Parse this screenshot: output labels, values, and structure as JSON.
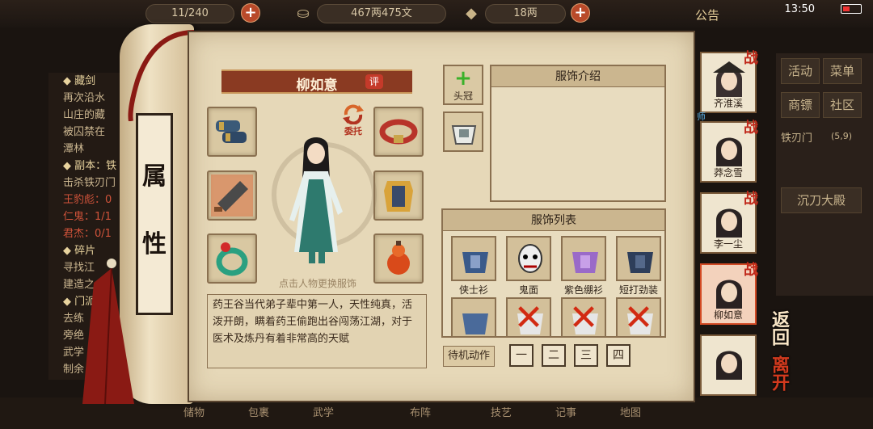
{
  "topbar": {
    "stamina": "11/240",
    "silver": "467两475文",
    "gold": "18两",
    "notice": "公告",
    "time": "13:50"
  },
  "quests": [
    {
      "text": "◆ 藏剑",
      "style": "h"
    },
    {
      "text": "再次沿水",
      "style": ""
    },
    {
      "text": "山庄的藏",
      "style": ""
    },
    {
      "text": "被囚禁在",
      "style": ""
    },
    {
      "text": "潭林",
      "style": ""
    },
    {
      "text": "◆ 副本：铁",
      "style": "h"
    },
    {
      "text": "击杀铁刃门",
      "style": ""
    },
    {
      "text": "王豹彪：0",
      "style": "hl"
    },
    {
      "text": "仁鬼：1/1",
      "style": "hl"
    },
    {
      "text": "君杰：0/1",
      "style": "hl"
    },
    {
      "text": "◆ 碎片",
      "style": "h"
    },
    {
      "text": "寻找江",
      "style": ""
    },
    {
      "text": "建造之",
      "style": ""
    },
    {
      "text": "◆ 门派",
      "style": "h"
    },
    {
      "text": "去练",
      "style": ""
    },
    {
      "text": "旁绝",
      "style": ""
    },
    {
      "text": "武学",
      "style": ""
    },
    {
      "text": "制余",
      "style": ""
    }
  ],
  "right_menu": {
    "activity": "活动",
    "menu": "菜单",
    "escort": "商镖",
    "community": "社区",
    "location": "铁刃门",
    "coords": "(5,9)",
    "dungeon": "沉刀大殿"
  },
  "scroll_label": [
    "属",
    "性"
  ],
  "character": {
    "name": "柳如意",
    "rate_label": "评",
    "entrust_label": "委托",
    "hint": "点击人物更换服饰",
    "description": "药王谷当代弟子辈中第一人，天性纯真，活泼开朗，瞒着药王偷跑出谷闯荡江湖，对于医术及炼丹有着非常高的天赋"
  },
  "headgear_label": "头冠",
  "intro_title": "服饰介绍",
  "list_title": "服饰列表",
  "costumes": [
    {
      "label": "侠士衫",
      "locked": false
    },
    {
      "label": "鬼面",
      "locked": false
    },
    {
      "label": "紫色绷衫",
      "locked": false
    },
    {
      "label": "短打劲装",
      "locked": false
    },
    {
      "label": "",
      "locked": false
    },
    {
      "label": "",
      "locked": true
    },
    {
      "label": "",
      "locked": true
    },
    {
      "label": "",
      "locked": true
    }
  ],
  "idle": {
    "label": "待机动作",
    "buttons": [
      "一",
      "二",
      "三",
      "四"
    ]
  },
  "party": [
    {
      "name": "齐淮溪",
      "tag": "战"
    },
    {
      "name": "莽念雪",
      "tag": "战"
    },
    {
      "name": "李一尘",
      "tag": "战"
    },
    {
      "name": "柳如意",
      "tag": "战"
    },
    {
      "name": "",
      "tag": ""
    }
  ],
  "mentor_tag": "师",
  "back_label": "返回",
  "leave_label": "离开",
  "bottom_items": [
    "储物",
    "包裹",
    "武学",
    "布阵",
    "技艺",
    "记事",
    "地图"
  ]
}
